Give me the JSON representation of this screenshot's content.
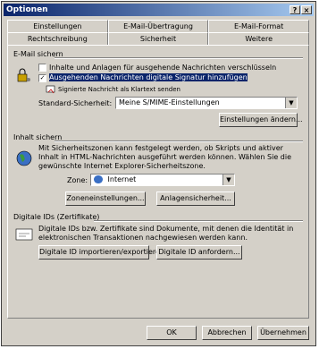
{
  "window": {
    "title": "Optionen",
    "buttons": [
      "?",
      "×"
    ]
  },
  "tabs": {
    "row1": [
      "Einstellungen",
      "E-Mail-Übertragung",
      "E-Mail-Format"
    ],
    "row2": [
      "Rechtschreibung",
      "Sicherheit",
      "Weitere"
    ],
    "active": "Sicherheit"
  },
  "email_secure": {
    "title": "E-Mail sichern",
    "encrypt_label": "Inhalte und Anlagen für ausgehende Nachrichten verschlüsseln",
    "sign_label": "Ausgehenden Nachrichten digitale Signatur hinzufügen",
    "cleartext_label": "Signierte Nachricht als Klartext senden",
    "default_label": "Standard-Sicherheit:",
    "default_value": "Meine S/MIME-Einstellungen",
    "settings_button": "Einstellungen ändern..."
  },
  "content_secure": {
    "title": "Inhalt sichern",
    "description": "Mit Sicherheitszonen kann festgelegt werden, ob Skripts und aktiver Inhalt in HTML-Nachrichten ausgeführt werden können. Wählen Sie die gewünschte Internet Explorer-Sicherheitszone.",
    "zone_label": "Zone:",
    "zone_value": "Internet",
    "zone_settings_button": "Zoneneinstellungen...",
    "attachment_button": "Anlagensicherheit..."
  },
  "digital_ids": {
    "title": "Digitale IDs (Zertifikate)",
    "description": "Digitale IDs bzw. Zertifikate sind Dokumente, mit denen die Identität in elektronischen Transaktionen nachgewiesen werden kann.",
    "import_button": "Digitale ID importieren/exportieren...",
    "get_button": "Digitale ID anfordern..."
  },
  "footer": {
    "ok": "OK",
    "cancel": "Abbrechen",
    "apply": "Übernehmen"
  },
  "colors": {
    "face": "#d4d0c8",
    "title_start": "#0a246a",
    "title_end": "#a6caf0"
  }
}
